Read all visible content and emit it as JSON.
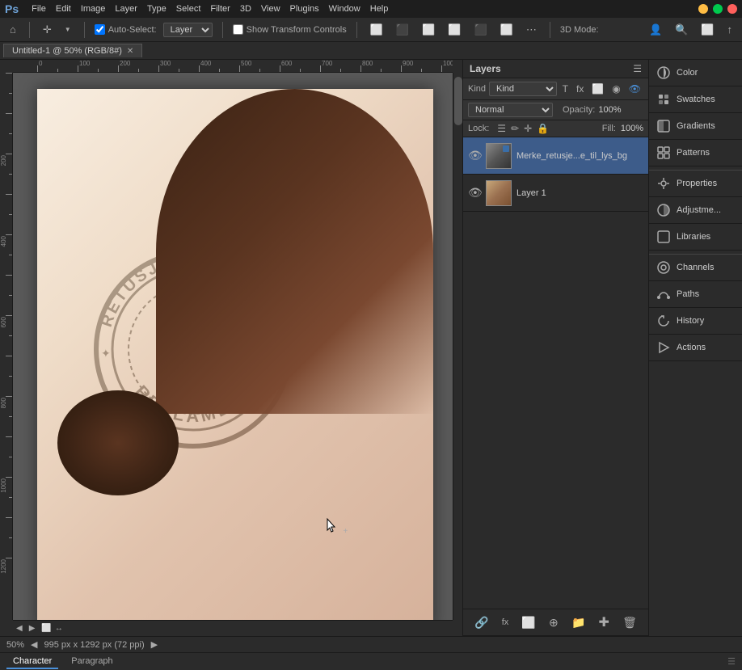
{
  "app": {
    "name": "Adobe Photoshop",
    "icon": "Ps"
  },
  "window_controls": {
    "minimize": "─",
    "maximize": "□",
    "close": "✕"
  },
  "menubar": {
    "items": [
      "File",
      "Edit",
      "Image",
      "Layer",
      "Type",
      "Select",
      "Filter",
      "3D",
      "View",
      "Plugins",
      "Window",
      "Help"
    ]
  },
  "toolbar": {
    "home_icon": "⌂",
    "move_tool": "✛",
    "auto_select_label": "Auto-Select:",
    "auto_select_value": "Layer",
    "show_transform": "Show Transform Controls",
    "align_icons": [
      "≡⬜",
      "⬜≡",
      "≡",
      "≡⬜⬜",
      "⬜≡⬜",
      "⬜⬜≡",
      "⋮"
    ],
    "threed_label": "3D Mode:",
    "user_icon": "👤",
    "search_icon": "🔍",
    "view_icon": "⬜",
    "share_icon": "↑"
  },
  "tab": {
    "title": "Untitled-1 @ 50% (RGB/8#)",
    "close": "✕"
  },
  "canvas": {
    "zoom": "50%",
    "doc_info": "995 px x 1292 px (72 ppi)"
  },
  "layers_panel": {
    "title": "Layers",
    "search_placeholder": "Kind",
    "blending_mode": "Normal",
    "opacity_label": "Opacity:",
    "opacity_value": "100%",
    "lock_label": "Lock:",
    "fill_label": "Fill:",
    "fill_value": "100%",
    "layers": [
      {
        "id": "layer-0",
        "name": "Merke_retusje...e_til_lys_bg",
        "visible": true,
        "active": true,
        "type": "smart"
      },
      {
        "id": "layer-1",
        "name": "Layer 1",
        "visible": true,
        "active": false,
        "type": "normal"
      }
    ],
    "footer_buttons": [
      "🔗",
      "fx",
      "⬜",
      "⊙",
      "📁",
      "✚",
      "🗑"
    ]
  },
  "properties_sidebar": {
    "items": [
      {
        "id": "color",
        "label": "Color",
        "icon": "◐"
      },
      {
        "id": "swatches",
        "label": "Swatches",
        "icon": "▦"
      },
      {
        "id": "gradients",
        "label": "Gradients",
        "icon": "◧"
      },
      {
        "id": "patterns",
        "label": "Patterns",
        "icon": "⊞"
      },
      {
        "id": "properties",
        "label": "Properties",
        "icon": "⚙"
      },
      {
        "id": "adjustments",
        "label": "Adjustme...",
        "icon": "◑"
      },
      {
        "id": "libraries",
        "label": "Libraries",
        "icon": "⬜"
      },
      {
        "id": "channels",
        "label": "Channels",
        "icon": "◉"
      },
      {
        "id": "paths",
        "label": "Paths",
        "icon": "✎"
      },
      {
        "id": "history",
        "label": "History",
        "icon": "⟳"
      },
      {
        "id": "actions",
        "label": "Actions",
        "icon": "▶"
      }
    ]
  },
  "statusbar": {
    "zoom": "50%",
    "doc_info": "995 px x 1292 px (72 ppi)",
    "nav_left": "◀",
    "nav_right": "▶"
  },
  "bottom_panel": {
    "tabs": [
      {
        "id": "character",
        "label": "Character",
        "active": true
      },
      {
        "id": "paragraph",
        "label": "Paragraph",
        "active": false
      }
    ]
  },
  "stamp": {
    "text_top": "RETUSJERT PERSON",
    "text_bottom": "REKLAME",
    "color": "#1a1a1a"
  }
}
